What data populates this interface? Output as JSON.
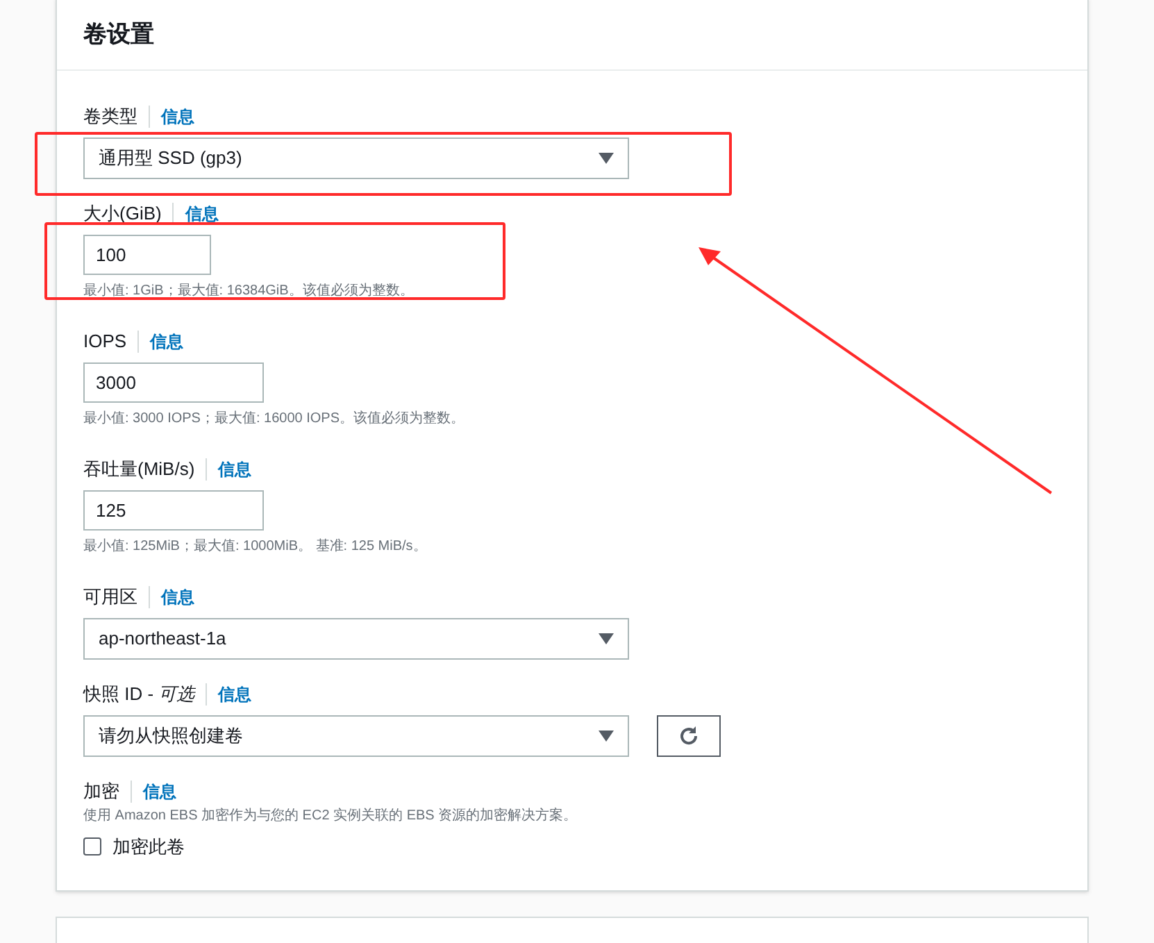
{
  "panel": {
    "title": "卷设置"
  },
  "fields": [
    {
      "kind": "select",
      "label": "卷类型",
      "info": "信息",
      "value": "通用型 SSD (gp3)"
    },
    {
      "kind": "input",
      "label": "大小(GiB)",
      "info": "信息",
      "value": "100",
      "hint": "最小值: 1GiB；最大值: 16384GiB。该值必须为整数。"
    },
    {
      "kind": "input",
      "label": "IOPS",
      "info": "信息",
      "value": "3000",
      "hint": "最小值: 3000 IOPS；最大值: 16000 IOPS。该值必须为整数。"
    },
    {
      "kind": "input",
      "label": "吞吐量(MiB/s)",
      "info": "信息",
      "value": "125",
      "hint": "最小值: 125MiB；最大值: 1000MiB。 基准: 125 MiB/s。"
    },
    {
      "kind": "select",
      "label": "可用区",
      "info": "信息",
      "value": "ap-northeast-1a"
    },
    {
      "kind": "select",
      "label": "快照 ID - ",
      "label_optional": "可选",
      "info": "信息",
      "value": "请勿从快照创建卷",
      "refresh": true
    },
    {
      "kind": "checkbox",
      "label": "加密",
      "info": "信息",
      "description": "使用 Amazon EBS 加密作为与您的 EC2 实例关联的 EBS 资源的加密解决方案。",
      "option": "加密此卷",
      "checked": false
    }
  ]
}
